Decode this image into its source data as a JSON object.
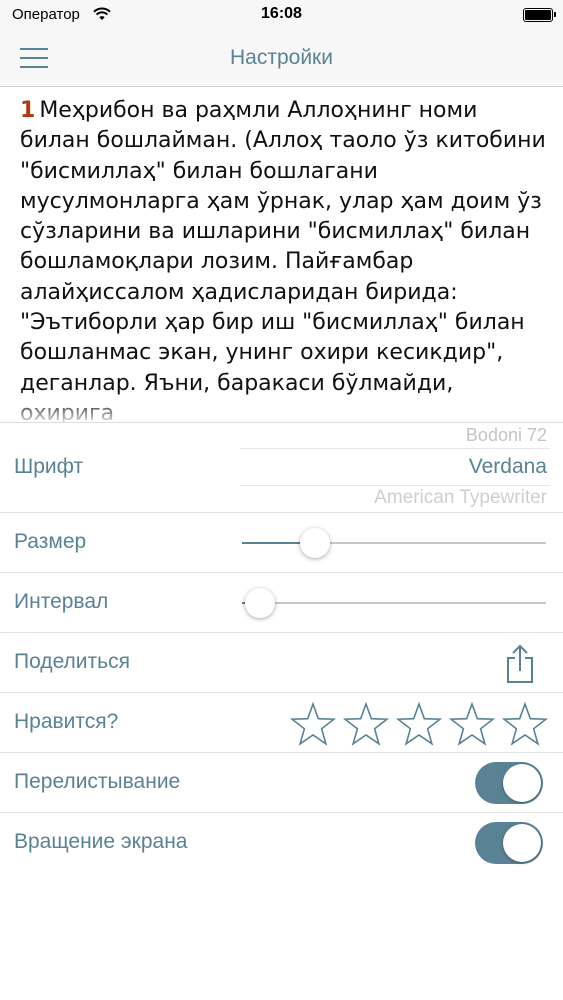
{
  "status_bar": {
    "carrier": "Оператор",
    "time": "16:08"
  },
  "nav": {
    "title": "Настройки"
  },
  "verse": {
    "number": "1",
    "text": "Меҳрибон ва раҳмли Аллоҳнинг номи билан бошлайман. (Аллоҳ таоло ўз китобини \"бисмиллаҳ\" билан бошлагани мусулмонларга ҳам ўрнак, улар ҳам доим ўз сўзларини ва ишларини \"бисмиллаҳ\" билан бошламоқлари лозим. Пайғамбар алайҳиссалом ҳадисларидан бирида: \"Эътиборли ҳар бир иш \"бисмиллаҳ\" билан бошланмас экан, унинг охири кесикдир\", деганлар. Яъни, баракаси бўлмайди, охирига"
  },
  "settings": {
    "font_label": "Шрифт",
    "font_options": [
      "Bodoni 72",
      "Verdana",
      "American Typewriter"
    ],
    "font_selected_index": 1,
    "size_label": "Размер",
    "size_value": 0.24,
    "spacing_label": "Интервал",
    "spacing_value": 0.06,
    "share_label": "Поделиться",
    "rate_label": "Нравится?",
    "rating": {
      "value": 0,
      "max": 5
    },
    "swipe_label": "Перелистывание",
    "swipe_on": true,
    "rotate_label": "Вращение экрана",
    "rotate_on": true
  },
  "icons": {
    "menu": "hamburger-menu-icon",
    "share": "share-icon",
    "star": "star-outline-icon",
    "wifi": "wifi-icon",
    "battery": "battery-icon"
  },
  "colors": {
    "accent": "#5a8295",
    "verse_number": "#b03a16",
    "separator": "#e2e2e2"
  }
}
